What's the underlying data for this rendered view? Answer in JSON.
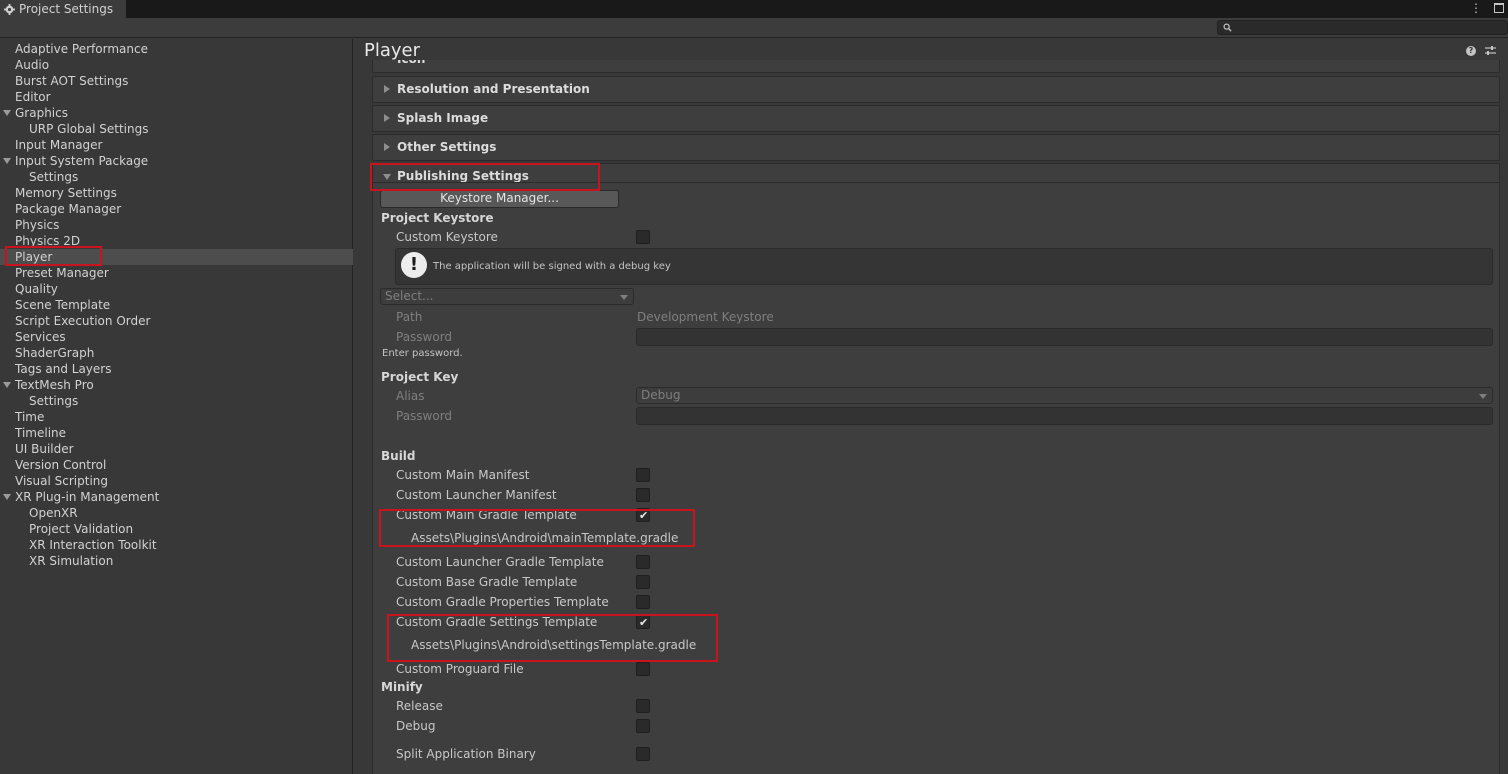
{
  "window": {
    "tab_title": "Project Settings",
    "menu_glyph": "⋮"
  },
  "search": {
    "placeholder": ""
  },
  "sidebar": {
    "items": [
      {
        "label": "Adaptive Performance"
      },
      {
        "label": "Audio"
      },
      {
        "label": "Burst AOT Settings"
      },
      {
        "label": "Editor"
      },
      {
        "label": "Graphics"
      },
      {
        "label": "URP Global Settings"
      },
      {
        "label": "Input Manager"
      },
      {
        "label": "Input System Package"
      },
      {
        "label": "Settings"
      },
      {
        "label": "Memory Settings"
      },
      {
        "label": "Package Manager"
      },
      {
        "label": "Physics"
      },
      {
        "label": "Physics 2D"
      },
      {
        "label": "Player"
      },
      {
        "label": "Preset Manager"
      },
      {
        "label": "Quality"
      },
      {
        "label": "Scene Template"
      },
      {
        "label": "Script Execution Order"
      },
      {
        "label": "Services"
      },
      {
        "label": "ShaderGraph"
      },
      {
        "label": "Tags and Layers"
      },
      {
        "label": "TextMesh Pro"
      },
      {
        "label": "Settings"
      },
      {
        "label": "Time"
      },
      {
        "label": "Timeline"
      },
      {
        "label": "UI Builder"
      },
      {
        "label": "Version Control"
      },
      {
        "label": "Visual Scripting"
      },
      {
        "label": "XR Plug-in Management"
      },
      {
        "label": "OpenXR"
      },
      {
        "label": "Project Validation"
      },
      {
        "label": "XR Interaction Toolkit"
      },
      {
        "label": "XR Simulation"
      }
    ]
  },
  "main": {
    "title": "Player",
    "help_glyph": "?",
    "sections": {
      "icon": "Icon",
      "resolution": "Resolution and Presentation",
      "splash": "Splash Image",
      "other": "Other Settings",
      "publishing": "Publishing Settings"
    },
    "publishing": {
      "keystore_manager_button": "Keystore Manager...",
      "project_keystore_heading": "Project Keystore",
      "custom_keystore_label": "Custom Keystore",
      "help_text": "The application will be signed with a debug key",
      "help_glyph": "!",
      "keystore_select": "Select...",
      "path_label": "Path",
      "path_value": "Development Keystore",
      "password_label": "Password",
      "enter_password": "Enter password.",
      "project_key_heading": "Project Key",
      "alias_label": "Alias",
      "alias_value": "Debug",
      "key_password_label": "Password",
      "build_heading": "Build",
      "build_options": {
        "custom_main_manifest": "Custom Main Manifest",
        "custom_launcher_manifest": "Custom Launcher Manifest",
        "custom_main_gradle": "Custom Main Gradle Template",
        "main_gradle_path": "Assets\\Plugins\\Android\\mainTemplate.gradle",
        "custom_launcher_gradle": "Custom Launcher Gradle Template",
        "custom_base_gradle": "Custom Base Gradle Template",
        "custom_gradle_properties": "Custom Gradle Properties Template",
        "custom_gradle_settings": "Custom Gradle Settings Template",
        "gradle_settings_path": "Assets\\Plugins\\Android\\settingsTemplate.gradle",
        "custom_proguard": "Custom Proguard File"
      },
      "checks": {
        "custom_keystore": false,
        "custom_main_manifest": false,
        "custom_launcher_manifest": false,
        "custom_main_gradle": true,
        "custom_launcher_gradle": false,
        "custom_base_gradle": false,
        "custom_gradle_properties": false,
        "custom_gradle_settings": true,
        "custom_proguard": false,
        "minify_release": false,
        "minify_debug": false,
        "split_binary": false
      },
      "check_glyph": "✔",
      "minify_heading": "Minify",
      "minify_release": "Release",
      "minify_debug": "Debug",
      "split_binary": "Split Application Binary"
    }
  },
  "colors": {
    "highlight_box": "#c9141e",
    "background": "#383838",
    "title_bar": "#191919"
  }
}
